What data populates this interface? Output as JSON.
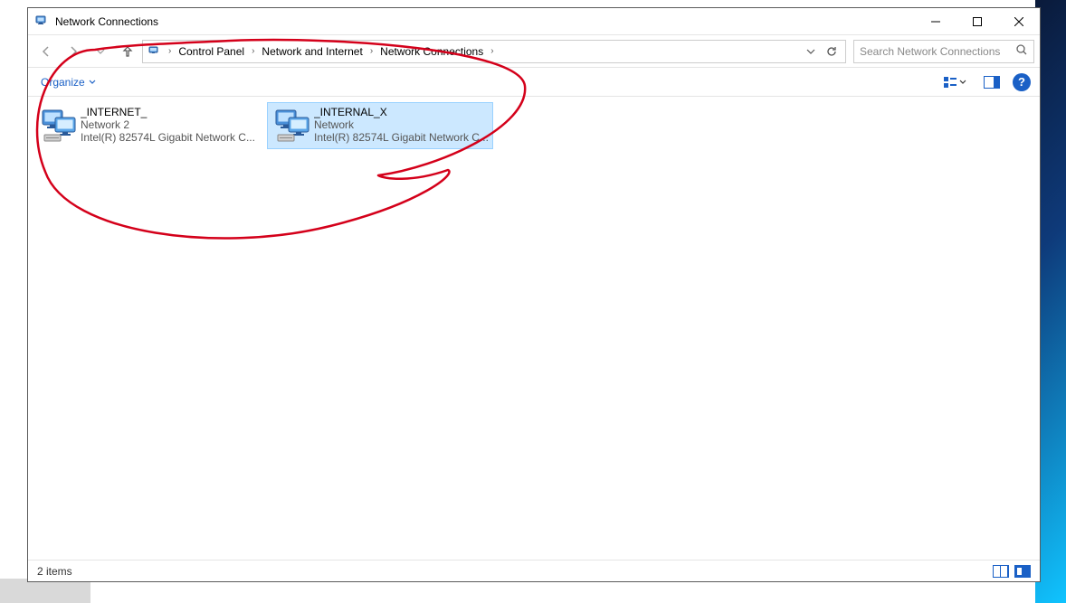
{
  "window": {
    "title": "Network Connections"
  },
  "breadcrumb": {
    "segments": [
      "Control Panel",
      "Network and Internet",
      "Network Connections"
    ]
  },
  "search": {
    "placeholder": "Search Network Connections"
  },
  "commandbar": {
    "organize": "Organize"
  },
  "connections": [
    {
      "name": "_INTERNET_",
      "status": "Network 2",
      "device": "Intel(R) 82574L Gigabit Network C...",
      "selected": false
    },
    {
      "name": "_INTERNAL_X",
      "status": "Network",
      "device": "Intel(R) 82574L Gigabit Network C...",
      "selected": true
    }
  ],
  "statusbar": {
    "text": "2 items"
  }
}
